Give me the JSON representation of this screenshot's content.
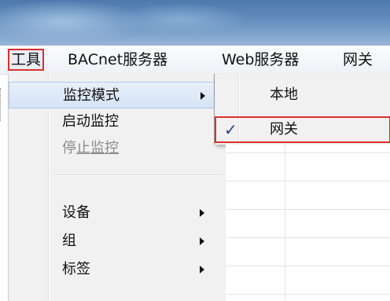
{
  "menubar": {
    "items": [
      {
        "label": "工具",
        "active": true
      },
      {
        "label": "BACnet服务器"
      },
      {
        "label": "Web服务器"
      },
      {
        "label": "网关"
      }
    ]
  },
  "tools_menu": {
    "items": [
      {
        "label": "监控模式",
        "has_submenu": true,
        "highlighted": true
      },
      {
        "label": "启动监控"
      },
      {
        "label": "停止监控",
        "disabled": true,
        "label_plain": "停",
        "label_underlined": "止监控"
      },
      {
        "label": "设备",
        "has_submenu": true
      },
      {
        "label": "组",
        "has_submenu": true
      },
      {
        "label": "标签",
        "has_submenu": true
      }
    ]
  },
  "monitor_mode_submenu": {
    "items": [
      {
        "label": "本地",
        "checked": false
      },
      {
        "label": "网关",
        "checked": true
      }
    ],
    "check_glyph": "✓"
  },
  "colors": {
    "highlight_border": "#d9302c",
    "menu_background": "#f1f1f1",
    "hover_background": "#dce8f6"
  }
}
